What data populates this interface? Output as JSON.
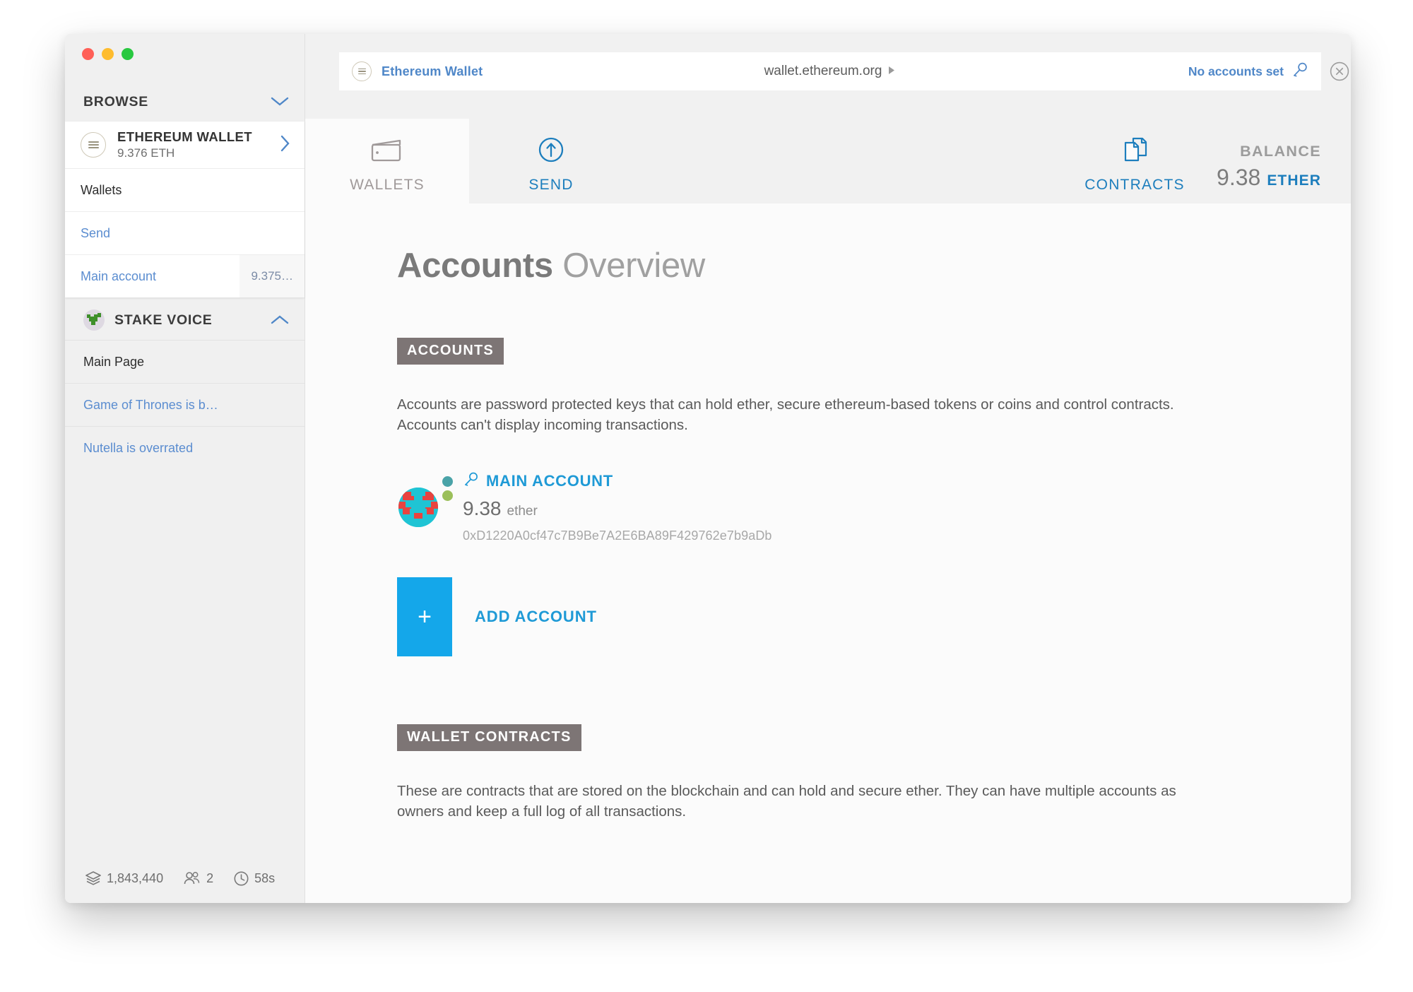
{
  "window": {
    "traffic_lights": [
      "close",
      "minimize",
      "zoom"
    ]
  },
  "sidebar": {
    "browse": {
      "title": "BROWSE",
      "collapse_icon": "chevron-down-icon",
      "app": {
        "name": "ETHEREUM WALLET",
        "balance": "9.376 ETH",
        "icon": "ethereum-wallet-icon",
        "arrow": "chevron-right-icon"
      },
      "items": [
        {
          "label": "Wallets",
          "style": "plain",
          "badge": ""
        },
        {
          "label": "Send",
          "style": "link",
          "badge": ""
        },
        {
          "label": "Main account",
          "style": "link",
          "badge": "9.375…"
        }
      ]
    },
    "stake_voice": {
      "title": "STAKE VOICE",
      "collapse_icon": "chevron-up-icon",
      "avatar": "stake-voice-avatar",
      "items": [
        {
          "label": "Main Page",
          "style": "plain"
        },
        {
          "label": "Game of Thrones is b…",
          "style": "link"
        },
        {
          "label": "Nutella is overrated",
          "style": "link"
        }
      ]
    },
    "status": {
      "blocks": "1,843,440",
      "peers": "2",
      "time": "58s"
    }
  },
  "urlbar": {
    "app_icon": "ethereum-wallet-icon",
    "app_title": "Ethereum Wallet",
    "host": "wallet.ethereum.org",
    "host_caret": "play-caret-icon",
    "accounts_status": "No accounts set",
    "key_icon": "key-icon",
    "close_icon": "close-circle-icon"
  },
  "nav": {
    "tabs": [
      {
        "label": "WALLETS",
        "icon": "wallet-icon",
        "active": true,
        "color": "#a09a9a"
      },
      {
        "label": "SEND",
        "icon": "send-arrow-up-circle-icon",
        "active": false,
        "color": "#1d7ebd"
      },
      {
        "label": "CONTRACTS",
        "icon": "contracts-documents-icon",
        "active": false,
        "color": "#1d7ebd"
      }
    ],
    "balance": {
      "label": "BALANCE",
      "value": "9.38",
      "unit": "ETHER"
    }
  },
  "main": {
    "title_bold": "Accounts",
    "title_light": "Overview",
    "accounts_section": {
      "tag": "ACCOUNTS",
      "description": "Accounts are password protected keys that can hold ether, secure ethereum-based tokens or coins and control contracts. Accounts can't display incoming transactions.",
      "accounts": [
        {
          "name": "MAIN ACCOUNT",
          "key_icon": "key-icon",
          "balance": "9.38",
          "unit": "ether",
          "address": "0xD1220A0cf47c7B9Be7A2E6BA89F429762e7b9aDb",
          "identicon": "identicon-avatar",
          "status_dots": [
            "#4aa3a8",
            "#9bbf5a"
          ]
        }
      ],
      "add_account": {
        "plus_icon": "plus-icon",
        "label": "ADD ACCOUNT"
      }
    },
    "wallet_contracts_section": {
      "tag": "WALLET CONTRACTS",
      "description": "These are contracts that are stored on the blockchain and can hold and secure ether. They can have multiple accounts as owners and keep a full log of all transactions."
    }
  },
  "colors": {
    "accent_blue": "#14a7ea",
    "link_blue": "#5b8dd0",
    "tag_gray": "#7d7575",
    "sidebar_bg": "#f0f0f0",
    "content_bg": "#fbfbfb"
  }
}
